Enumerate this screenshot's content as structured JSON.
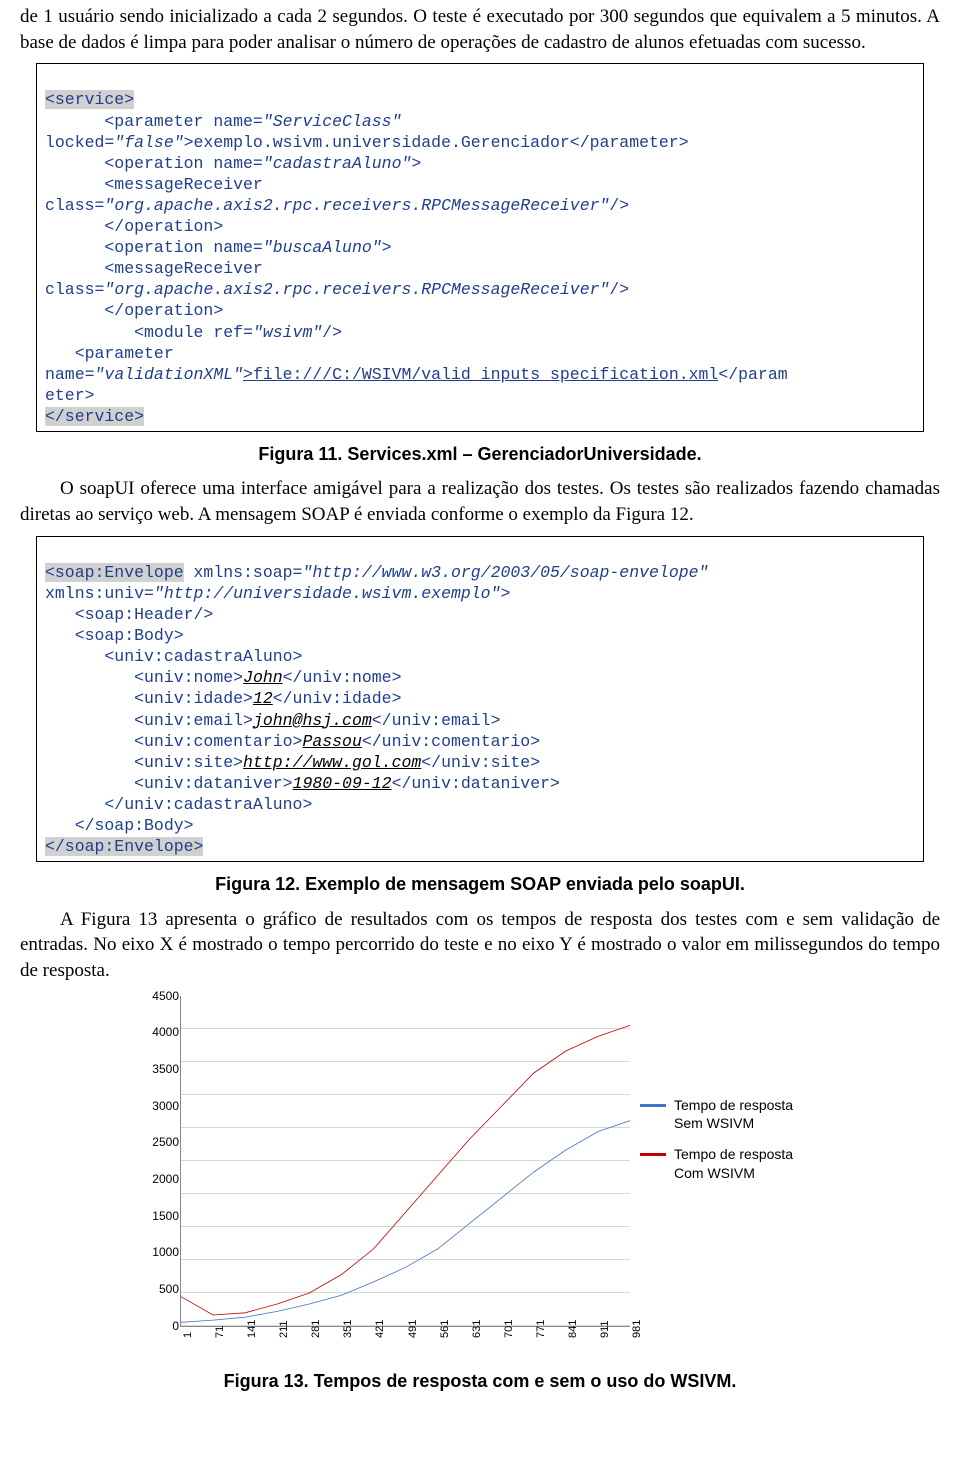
{
  "intro_paragraph": "de 1 usuário sendo inicializado a cada 2 segundos. O teste é executado por 300 segundos que equivalem a 5 minutos. A base de dados é limpa para poder analisar o número de operações de cadastro de alunos efetuadas com sucesso.",
  "code1": {
    "l1": "<service>",
    "l2a": "      <parameter name=",
    "l2b": "\"ServiceClass\"",
    "l3a": "locked=",
    "l3b": "\"false\"",
    "l3c": ">exemplo.wsivm.universidade.Gerenciador</parameter>",
    "l4a": "      <operation name=",
    "l4b": "\"cadastraAluno\"",
    "l4c": ">",
    "l5": "      <messageReceiver",
    "l6a": "class=",
    "l6b": "\"org.apache.axis2.rpc.receivers.RPCMessageReceiver\"",
    "l6c": "/>",
    "l7": "      </operation>",
    "l8a": "      <operation name=",
    "l8b": "\"buscaAluno\"",
    "l8c": ">",
    "l9": "      <messageReceiver",
    "l10a": "class=",
    "l10b": "\"org.apache.axis2.rpc.receivers.RPCMessageReceiver\"",
    "l10c": "/>",
    "l11": "      </operation>",
    "l12a": "         <module ref=",
    "l12b": "\"wsivm\"",
    "l12c": "/>",
    "l13": "   <parameter",
    "l14a": "name=",
    "l14b": "\"validationXML\"",
    "l14c": ">file:///C:/WSIVM/valid_inputs_specification.xml",
    "l14d": "</param",
    "l15": "eter>",
    "l16": "</service>"
  },
  "caption1": "Figura 11. Services.xml – GerenciadorUniversidade.",
  "para2": "O soapUI oferece uma interface amigável para a realização dos testes. Os testes são realizados fazendo chamadas diretas ao serviço web. A mensagem SOAP é enviada conforme o exemplo da Figura 12.",
  "code2": {
    "l1a": "<soap:Envelope",
    "l1b": " xmlns:soap=",
    "l1c": "\"http://www.w3.org/2003/05/soap-envelope\"",
    "l2a": "xmlns:univ=",
    "l2b": "\"http://universidade.wsivm.exemplo\"",
    "l2c": ">",
    "l3": "   <soap:Header/>",
    "l4": "   <soap:Body>",
    "l5": "      <univ:cadastraAluno>",
    "l6a": "         <univ:nome>",
    "l6b": "John",
    "l6c": "</univ:nome>",
    "l7a": "         <univ:idade>",
    "l7b": "12",
    "l7c": "</univ:idade>",
    "l8a": "         <univ:email>",
    "l8b": "john@hsj.com",
    "l8c": "</univ:email>",
    "l9a": "         <univ:comentario>",
    "l9b": "Passou",
    "l9c": "</univ:comentario>",
    "l10a": "         <univ:site>",
    "l10b": "http://www.gol.com",
    "l10c": "</univ:site>",
    "l11a": "         <univ:dataniver>",
    "l11b": "1980-09-12",
    "l11c": "</univ:dataniver>",
    "l12": "      </univ:cadastraAluno>",
    "l13": "   </soap:Body>",
    "l14": "</soap:Envelope>"
  },
  "caption2": "Figura 12. Exemplo de mensagem SOAP enviada pelo soapUI.",
  "para3": "A Figura 13 apresenta o gráfico de resultados com os tempos de resposta dos testes com e sem validação de entradas. No eixo X é mostrado o tempo percorrido do teste e no eixo Y é mostrado o valor em milissegundos do tempo de resposta.",
  "caption3": "Figura 13. Tempos de resposta com e sem o uso do WSIVM.",
  "chart_data": {
    "type": "line",
    "x": [
      1,
      71,
      141,
      211,
      281,
      351,
      421,
      491,
      561,
      631,
      701,
      771,
      841,
      911,
      981
    ],
    "series": [
      {
        "name": "Tempo de resposta Sem WSIVM",
        "color": "#4472c4",
        "values": [
          50,
          80,
          120,
          200,
          300,
          420,
          600,
          800,
          1050,
          1400,
          1750,
          2100,
          2400,
          2650,
          2800
        ]
      },
      {
        "name": "Tempo de resposta Com WSIVM",
        "color": "#c00000",
        "values": [
          400,
          150,
          180,
          300,
          450,
          700,
          1050,
          1550,
          2050,
          2550,
          3000,
          3450,
          3750,
          3950,
          4100
        ]
      }
    ],
    "ylim": [
      0,
      4500
    ],
    "y_ticks": [
      0,
      500,
      1000,
      1500,
      2000,
      2500,
      3000,
      3500,
      4000,
      4500
    ],
    "x_ticks": [
      1,
      71,
      141,
      211,
      281,
      351,
      421,
      491,
      561,
      631,
      701,
      771,
      841,
      911,
      981
    ],
    "xlabel": "",
    "ylabel": "",
    "title": ""
  }
}
